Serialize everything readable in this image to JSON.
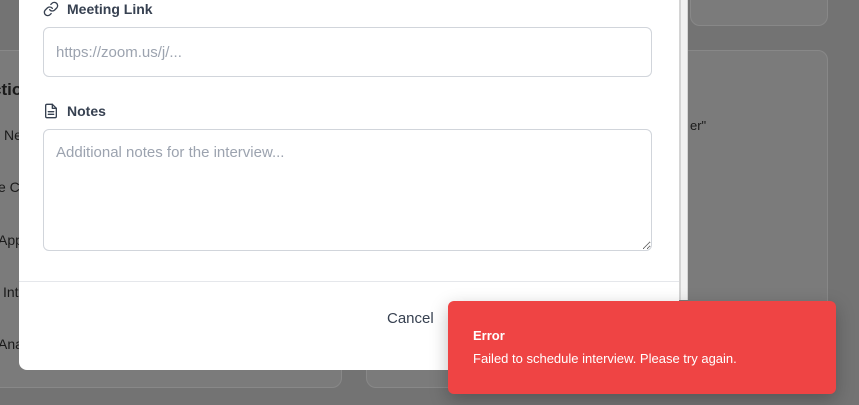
{
  "background": {
    "fragments": [
      "ctio",
      "Ne",
      "e Ca",
      "App",
      "Int",
      "Ana",
      "er\""
    ]
  },
  "modal": {
    "meeting_link": {
      "label": "Meeting Link",
      "placeholder": "https://zoom.us/j/...",
      "icon": "link-icon"
    },
    "notes": {
      "label": "Notes",
      "placeholder": "Additional notes for the interview...",
      "icon": "document-icon"
    },
    "cancel_label": "Cancel"
  },
  "toast": {
    "title": "Error",
    "message": "Failed to schedule interview. Please try again.",
    "color": "#ef4444"
  }
}
